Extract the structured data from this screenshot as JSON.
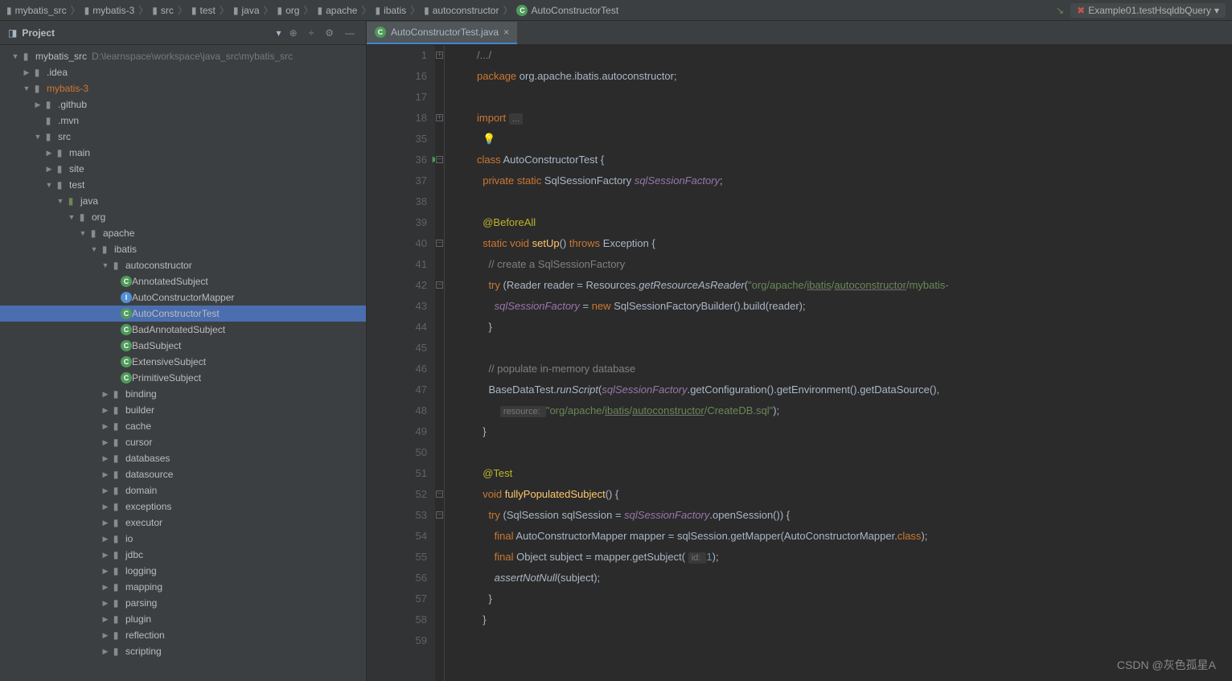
{
  "breadcrumb": {
    "items": [
      "mybatis_src",
      "mybatis-3",
      "src",
      "test",
      "java",
      "org",
      "apache",
      "ibatis",
      "autoconstructor",
      "AutoConstructorTest"
    ]
  },
  "runConfig": "Example01.testHsqldbQuery",
  "project": {
    "title": "Project",
    "root": {
      "name": "mybatis_src",
      "path": "D:\\learnspace\\workspace\\java_src\\mybatis_src"
    },
    "tree": [
      {
        "depth": 1,
        "arrow": "open",
        "icon": "folder",
        "label": "mybatis_src",
        "path_after": "D:\\learnspace\\workspace\\java_src\\mybatis_src"
      },
      {
        "depth": 2,
        "arrow": "closed",
        "icon": "folder",
        "label": ".idea"
      },
      {
        "depth": 2,
        "arrow": "open",
        "icon": "folder",
        "label": "mybatis-3",
        "orange": true
      },
      {
        "depth": 3,
        "arrow": "closed",
        "icon": "folder",
        "label": ".github"
      },
      {
        "depth": 3,
        "arrow": "",
        "icon": "folder",
        "label": ".mvn"
      },
      {
        "depth": 3,
        "arrow": "open",
        "icon": "folder",
        "label": "src"
      },
      {
        "depth": 4,
        "arrow": "closed",
        "icon": "folder",
        "label": "main"
      },
      {
        "depth": 4,
        "arrow": "closed",
        "icon": "folder",
        "label": "site"
      },
      {
        "depth": 4,
        "arrow": "open",
        "icon": "folder",
        "label": "test"
      },
      {
        "depth": 5,
        "arrow": "open",
        "icon": "folder-src",
        "label": "java"
      },
      {
        "depth": 6,
        "arrow": "open",
        "icon": "folder",
        "label": "org"
      },
      {
        "depth": 7,
        "arrow": "open",
        "icon": "folder",
        "label": "apache"
      },
      {
        "depth": 8,
        "arrow": "open",
        "icon": "folder",
        "label": "ibatis"
      },
      {
        "depth": 9,
        "arrow": "open",
        "icon": "folder",
        "label": "autoconstructor"
      },
      {
        "depth": 10,
        "arrow": "",
        "icon": "class",
        "label": "AnnotatedSubject"
      },
      {
        "depth": 10,
        "arrow": "",
        "icon": "interface",
        "label": "AutoConstructorMapper"
      },
      {
        "depth": 10,
        "arrow": "",
        "icon": "class",
        "label": "AutoConstructorTest",
        "selected": true
      },
      {
        "depth": 10,
        "arrow": "",
        "icon": "class",
        "label": "BadAnnotatedSubject"
      },
      {
        "depth": 10,
        "arrow": "",
        "icon": "class",
        "label": "BadSubject"
      },
      {
        "depth": 10,
        "arrow": "",
        "icon": "class",
        "label": "ExtensiveSubject"
      },
      {
        "depth": 10,
        "arrow": "",
        "icon": "class",
        "label": "PrimitiveSubject"
      },
      {
        "depth": 9,
        "arrow": "closed",
        "icon": "folder",
        "label": "binding"
      },
      {
        "depth": 9,
        "arrow": "closed",
        "icon": "folder",
        "label": "builder"
      },
      {
        "depth": 9,
        "arrow": "closed",
        "icon": "folder",
        "label": "cache"
      },
      {
        "depth": 9,
        "arrow": "closed",
        "icon": "folder",
        "label": "cursor"
      },
      {
        "depth": 9,
        "arrow": "closed",
        "icon": "folder",
        "label": "databases"
      },
      {
        "depth": 9,
        "arrow": "closed",
        "icon": "folder",
        "label": "datasource"
      },
      {
        "depth": 9,
        "arrow": "closed",
        "icon": "folder",
        "label": "domain"
      },
      {
        "depth": 9,
        "arrow": "closed",
        "icon": "folder",
        "label": "exceptions"
      },
      {
        "depth": 9,
        "arrow": "closed",
        "icon": "folder",
        "label": "executor"
      },
      {
        "depth": 9,
        "arrow": "closed",
        "icon": "folder",
        "label": "io"
      },
      {
        "depth": 9,
        "arrow": "closed",
        "icon": "folder",
        "label": "jdbc"
      },
      {
        "depth": 9,
        "arrow": "closed",
        "icon": "folder",
        "label": "logging"
      },
      {
        "depth": 9,
        "arrow": "closed",
        "icon": "folder",
        "label": "mapping"
      },
      {
        "depth": 9,
        "arrow": "closed",
        "icon": "folder",
        "label": "parsing"
      },
      {
        "depth": 9,
        "arrow": "closed",
        "icon": "folder",
        "label": "plugin"
      },
      {
        "depth": 9,
        "arrow": "closed",
        "icon": "folder",
        "label": "reflection"
      },
      {
        "depth": 9,
        "arrow": "closed",
        "icon": "folder",
        "label": "scripting"
      }
    ]
  },
  "tab": {
    "name": "AutoConstructorTest.java"
  },
  "gutter": [
    "1",
    "16",
    "17",
    "18",
    "35",
    "36",
    "37",
    "38",
    "39",
    "40",
    "41",
    "42",
    "43",
    "44",
    "45",
    "46",
    "47",
    "48",
    "49",
    "50",
    "51",
    "52",
    "53",
    "54",
    "55",
    "56",
    "57",
    "58",
    "59"
  ],
  "code": [
    {
      "tokens": [
        {
          "t": "/.../",
          "c": "c-com"
        }
      ],
      "fold": "+"
    },
    {
      "tokens": [
        {
          "t": "package ",
          "c": "c-kw"
        },
        {
          "t": "org.apache.ibatis.autoconstructor;",
          "c": ""
        }
      ]
    },
    {
      "tokens": []
    },
    {
      "tokens": [
        {
          "t": "import ",
          "c": "c-kw"
        },
        {
          "t": "...",
          "c": "c-hint"
        }
      ],
      "fold": "+"
    },
    {
      "tokens": [
        {
          "t": "  💡",
          "c": ""
        }
      ]
    },
    {
      "tokens": [
        {
          "t": "class ",
          "c": "c-kw"
        },
        {
          "t": "AutoConstructorTest ",
          "c": "c-cls"
        },
        {
          "t": "{",
          "c": ""
        }
      ],
      "run": "▶▶",
      "fold": "-"
    },
    {
      "tokens": [
        {
          "t": "  private static ",
          "c": "c-kw"
        },
        {
          "t": "SqlSessionFactory ",
          "c": ""
        },
        {
          "t": "sqlSessionFactory",
          "c": "c-fld"
        },
        {
          "t": ";",
          "c": ""
        }
      ]
    },
    {
      "tokens": []
    },
    {
      "tokens": [
        {
          "t": "  @BeforeAll",
          "c": "c-ann"
        }
      ]
    },
    {
      "tokens": [
        {
          "t": "  static void ",
          "c": "c-kw"
        },
        {
          "t": "setUp",
          "c": "c-fn"
        },
        {
          "t": "() ",
          "c": ""
        },
        {
          "t": "throws ",
          "c": "c-kw"
        },
        {
          "t": "Exception {",
          "c": ""
        }
      ],
      "fold": "-"
    },
    {
      "tokens": [
        {
          "t": "    // create a SqlSessionFactory",
          "c": "c-com"
        }
      ]
    },
    {
      "tokens": [
        {
          "t": "    try ",
          "c": "c-kw"
        },
        {
          "t": "(Reader reader = Resources.",
          "c": ""
        },
        {
          "t": "getResourceAsReader",
          "c": "c-stat"
        },
        {
          "t": "(",
          "c": ""
        },
        {
          "t": "\"org/apache/",
          "c": "c-str"
        },
        {
          "t": "ibatis",
          "c": "c-str c-under"
        },
        {
          "t": "/",
          "c": "c-str"
        },
        {
          "t": "autoconstructor",
          "c": "c-str c-under"
        },
        {
          "t": "/mybatis-",
          "c": "c-str"
        }
      ],
      "fold": "-"
    },
    {
      "tokens": [
        {
          "t": "      sqlSessionFactory",
          "c": "c-fld"
        },
        {
          "t": " = ",
          "c": ""
        },
        {
          "t": "new ",
          "c": "c-kw"
        },
        {
          "t": "SqlSessionFactoryBuilder().build(reader);",
          "c": ""
        }
      ]
    },
    {
      "tokens": [
        {
          "t": "    }",
          "c": ""
        }
      ]
    },
    {
      "tokens": []
    },
    {
      "tokens": [
        {
          "t": "    // populate in-memory database",
          "c": "c-com"
        }
      ]
    },
    {
      "tokens": [
        {
          "t": "    BaseDataTest.",
          "c": ""
        },
        {
          "t": "runScript",
          "c": "c-stat"
        },
        {
          "t": "(",
          "c": ""
        },
        {
          "t": "sqlSessionFactory",
          "c": "c-fld"
        },
        {
          "t": ".getConfiguration().getEnvironment().getDataSource(),",
          "c": ""
        }
      ]
    },
    {
      "tokens": [
        {
          "t": "        ",
          "c": ""
        },
        {
          "t": "resource: ",
          "c": "c-hint"
        },
        {
          "t": "\"org/apache/",
          "c": "c-str"
        },
        {
          "t": "ibatis",
          "c": "c-str c-under"
        },
        {
          "t": "/",
          "c": "c-str"
        },
        {
          "t": "autoconstructor",
          "c": "c-str c-under"
        },
        {
          "t": "/CreateDB.sql\"",
          "c": "c-str"
        },
        {
          "t": ");",
          "c": ""
        }
      ]
    },
    {
      "tokens": [
        {
          "t": "  }",
          "c": ""
        }
      ]
    },
    {
      "tokens": []
    },
    {
      "tokens": [
        {
          "t": "  @Test",
          "c": "c-ann"
        }
      ]
    },
    {
      "tokens": [
        {
          "t": "  void ",
          "c": "c-kw"
        },
        {
          "t": "fullyPopulatedSubject",
          "c": "c-fn"
        },
        {
          "t": "() {",
          "c": ""
        }
      ],
      "run": "▶",
      "fold": "-"
    },
    {
      "tokens": [
        {
          "t": "    try ",
          "c": "c-kw"
        },
        {
          "t": "(SqlSession sqlSession = ",
          "c": ""
        },
        {
          "t": "sqlSessionFactory",
          "c": "c-fld"
        },
        {
          "t": ".openSession()) {",
          "c": ""
        }
      ],
      "fold": "-"
    },
    {
      "tokens": [
        {
          "t": "      final ",
          "c": "c-kw"
        },
        {
          "t": "AutoConstructorMapper mapper = sqlSession.getMapper(AutoConstructorMapper.",
          "c": ""
        },
        {
          "t": "class",
          "c": "c-kw"
        },
        {
          "t": ");",
          "c": ""
        }
      ]
    },
    {
      "tokens": [
        {
          "t": "      final ",
          "c": "c-kw"
        },
        {
          "t": "Object subject = mapper.getSubject( ",
          "c": ""
        },
        {
          "t": "id: ",
          "c": "c-hint"
        },
        {
          "t": "1",
          "c": "c-num"
        },
        {
          "t": ");",
          "c": ""
        }
      ]
    },
    {
      "tokens": [
        {
          "t": "      assertNotNull",
          "c": "c-stat"
        },
        {
          "t": "(subject);",
          "c": ""
        }
      ]
    },
    {
      "tokens": [
        {
          "t": "    }",
          "c": ""
        }
      ]
    },
    {
      "tokens": [
        {
          "t": "  }",
          "c": ""
        }
      ]
    },
    {
      "tokens": []
    }
  ],
  "watermark": "CSDN @灰色孤星A"
}
